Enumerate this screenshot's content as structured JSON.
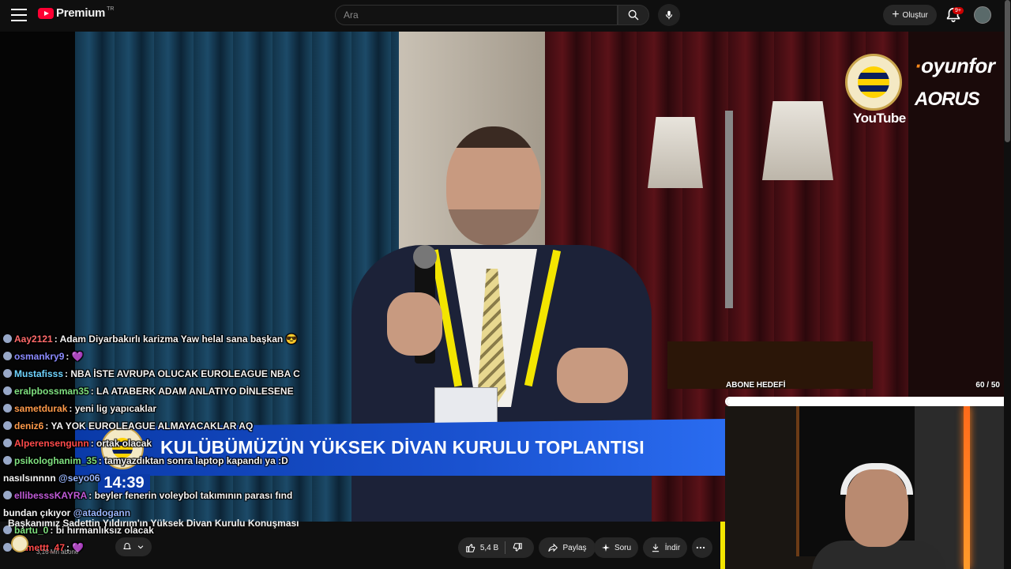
{
  "header": {
    "brand": "Premium",
    "region": "TR",
    "search_placeholder": "Ara",
    "create_label": "Oluştur",
    "notifications_badge": "9+"
  },
  "stream_overlay": {
    "youtube_label": "YouTube",
    "sponsor_1": "oyunfor",
    "sponsor_2": "AORUS",
    "banner_text": "KULÜBÜMÜZÜN YÜKSEK DİVAN KURULU TOPLANTISI",
    "banner_time": "14:39",
    "goal_label": "ABONE HEDEFİ",
    "goal_count": "60 / 50",
    "goal_progress": 1.0
  },
  "chat": [
    {
      "user": "Aay2121",
      "user_color": "#ff6a6a",
      "msg": ": Adam Diyarbakırlı karizma Yaw helal sana başkan 😎"
    },
    {
      "user": "osmankry9",
      "user_color": "#8a8aff",
      "msg": ": 💜"
    },
    {
      "user": "Mustafisss",
      "user_color": "#6fd4ff",
      "msg": ": NBA İSTE AVRUPA OLUCAK EUROLEAGUE NBA C"
    },
    {
      "user": "eralpbossman35",
      "user_color": "#7fe07f",
      "msg": ": LA ATABERK ADAM ANLATIYO DİNLESENE"
    },
    {
      "user": "sametdurak",
      "user_color": "#ff9a4a",
      "msg": ": yeni lig yapıcaklar"
    },
    {
      "user": "deniz6",
      "user_color": "#ff9a4a",
      "msg": ": YA YOK EUROLEAGUE ALMAYACAKLAR AQ"
    },
    {
      "user": "Alperensengunn",
      "user_color": "#ff4a4a",
      "msg": ": ortak olacak"
    },
    {
      "user": "psikologhanim_35",
      "user_color": "#7fe07f",
      "msg": ": tamyazdıktan sonra laptop kapandı ya :D"
    },
    {
      "user": "",
      "user_color": "#ffffff",
      "msg": "nasılsınnnn",
      "mention": "@seyo06"
    },
    {
      "user": "ellibesssKAYRA",
      "user_color": "#c05ad8",
      "msg": ": beyler fenerin voleybol takımının parası fınd"
    },
    {
      "user": "",
      "user_color": "#ffffff",
      "msg": "bundan çıkıyor",
      "mention": "@atadogann"
    },
    {
      "user": "bartu_0",
      "user_color": "#7fe07f",
      "msg": ": bi hırmanlıksız olacak"
    },
    {
      "user": "Samettt_47",
      "user_color": "#ff4a4a",
      "msg": ": 💜"
    }
  ],
  "video": {
    "title": "Başkanımız Sadettin Yıldırım'ın Yüksek Divan Kurulu Konuşması",
    "channel_subs": "3,16 Mn abone",
    "like_count": "5,4 B",
    "share_label": "Paylaş",
    "ask_label": "Soru",
    "download_label": "İndir"
  },
  "colors": {
    "background": "#0f0f0f",
    "brand_red": "#ff0033",
    "banner_blue": "#1a52d0",
    "pill_bg": "#272727"
  }
}
